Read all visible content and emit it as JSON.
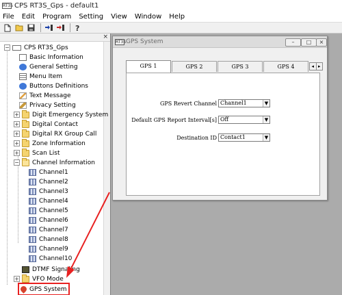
{
  "app": {
    "title": "CPS RT3S_Gps - default1",
    "icon_text": "RT3S"
  },
  "menu": [
    "File",
    "Edit",
    "Program",
    "Setting",
    "View",
    "Window",
    "Help"
  ],
  "toolbar": {
    "buttons": [
      "new-file-icon",
      "open-folder-icon",
      "save-icon",
      "read-radio-icon",
      "write-radio-icon",
      "help-icon"
    ]
  },
  "panel": {
    "close_glyph": "×"
  },
  "tree": {
    "root": "CPS RT3S_Gps",
    "items": [
      {
        "label": "Basic Information",
        "icon": "doc-icon"
      },
      {
        "label": "General Setting",
        "icon": "blue-circle-icon"
      },
      {
        "label": "Menu Item",
        "icon": "menu-icon"
      },
      {
        "label": "Buttons Definitions",
        "icon": "blue-circle-icon"
      },
      {
        "label": "Text Message",
        "icon": "envelope-icon"
      },
      {
        "label": "Privacy Setting",
        "icon": "key-icon"
      },
      {
        "label": "Digit Emergency System",
        "icon": "folder-icon"
      },
      {
        "label": "Digital Contact",
        "icon": "folder-icon"
      },
      {
        "label": "Digital RX Group Call",
        "icon": "folder-icon"
      },
      {
        "label": "Zone Information",
        "icon": "folder-icon"
      },
      {
        "label": "Scan List",
        "icon": "folder-icon"
      },
      {
        "label": "Channel Information",
        "icon": "folder-open-icon"
      },
      {
        "label": "Channel1",
        "icon": "grid-icon"
      },
      {
        "label": "Channel2",
        "icon": "grid-icon"
      },
      {
        "label": "Channel3",
        "icon": "grid-icon"
      },
      {
        "label": "Channel4",
        "icon": "grid-icon"
      },
      {
        "label": "Channel5",
        "icon": "grid-icon"
      },
      {
        "label": "Channel6",
        "icon": "grid-icon"
      },
      {
        "label": "Channel7",
        "icon": "grid-icon"
      },
      {
        "label": "Channel8",
        "icon": "grid-icon"
      },
      {
        "label": "Channel9",
        "icon": "grid-icon"
      },
      {
        "label": "Channel10",
        "icon": "grid-icon"
      },
      {
        "label": "DTMF Signaling",
        "icon": "dtmf-icon"
      },
      {
        "label": "VFO Mode",
        "icon": "folder-icon"
      },
      {
        "label": "GPS System",
        "icon": "gps-icon"
      }
    ],
    "expand_glyph": "+",
    "collapse_glyph": "−"
  },
  "gps_window": {
    "title": "GPS System",
    "icon_text": "RT3S",
    "minimize_glyph": "–",
    "maximize_glyph": "□",
    "close_glyph": "×",
    "tabs": [
      "GPS 1",
      "GPS 2",
      "GPS 3",
      "GPS 4"
    ],
    "active_tab": "GPS 1",
    "tab_scroll_left": "◂",
    "tab_scroll_right": "▸",
    "fields": [
      {
        "label": "GPS Revert Channel",
        "value": "Channel1"
      },
      {
        "label": "Default GPS Report Interval[s]",
        "value": "Off"
      },
      {
        "label": "Destination ID",
        "value": "Contact1"
      }
    ],
    "dropdown_glyph": "▼"
  },
  "colors": {
    "annotation_red": "#e82020",
    "mdi_background": "#ababab"
  }
}
